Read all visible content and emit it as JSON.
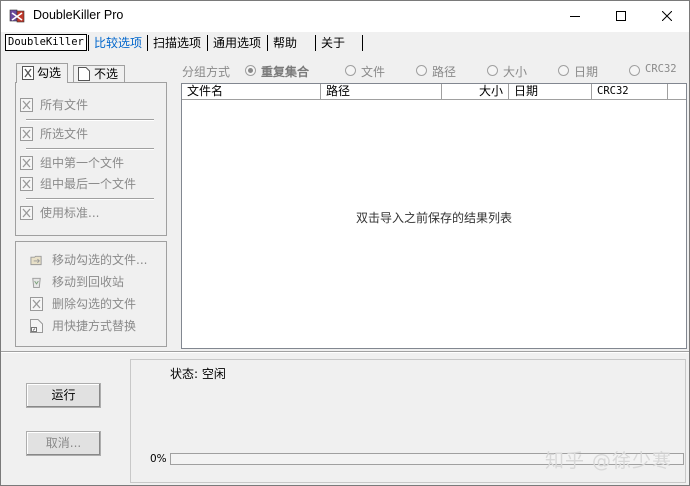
{
  "window": {
    "title": "DoubleKiller Pro"
  },
  "tabs": {
    "doublekiller": "DoubleKiller",
    "compare": "比较选项",
    "scan": "扫描选项",
    "general": "通用选项",
    "help": "帮助",
    "about": "关于"
  },
  "subtabs": {
    "check": "勾选",
    "uncheck": "不选"
  },
  "check_menu": {
    "all_files": "所有文件",
    "selected_files": "所选文件",
    "first_in_group": "组中第一个文件",
    "last_in_group": "组中最后一个文件",
    "use_criteria": "使用标准..."
  },
  "actions": {
    "move_checked": "移动勾选的文件...",
    "move_recycle": "移动到回收站",
    "delete_checked": "删除勾选的文件",
    "shortcut_replace": "用快捷方式替换"
  },
  "grouping": {
    "label": "分组方式",
    "options": [
      "重复集合",
      "文件",
      "路径",
      "大小",
      "日期",
      "CRC32"
    ],
    "selected": "重复集合"
  },
  "columns": [
    "文件名",
    "路径",
    "大小",
    "日期",
    "CRC32"
  ],
  "list": {
    "empty_message": "双击导入之前保存的结果列表"
  },
  "buttons": {
    "run": "运行",
    "cancel": "取消..."
  },
  "status": {
    "text": "状态: 空闲",
    "progress_label": "0%",
    "progress": 0
  },
  "watermark": "知乎 @徐少寒",
  "colors": {
    "active_tab": "#0066cc",
    "disabled_text": "#8a8a8a"
  }
}
